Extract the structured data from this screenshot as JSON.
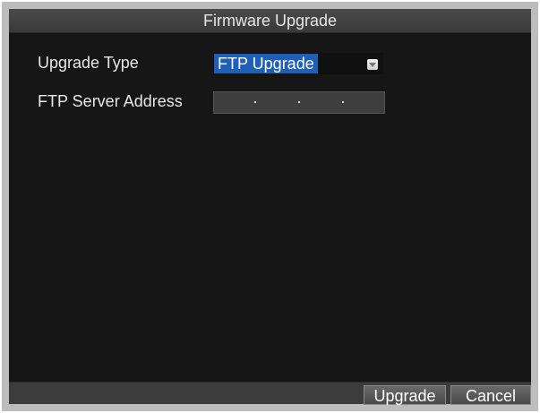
{
  "window": {
    "title": "Firmware Upgrade"
  },
  "form": {
    "upgrade_type_label": "Upgrade Type",
    "upgrade_type_value": "FTP Upgrade",
    "ftp_server_label": "FTP Server Address",
    "ftp_server_value": ". . ."
  },
  "buttons": {
    "upgrade_label": "Upgrade",
    "cancel_label": "Cancel"
  },
  "colors": {
    "background": "#161616",
    "title_bar": "#3f3f3f",
    "selection": "#1f5fb5",
    "frame": "#bdbdbd"
  },
  "icons": {
    "dropdown": "chevron-down-icon"
  }
}
